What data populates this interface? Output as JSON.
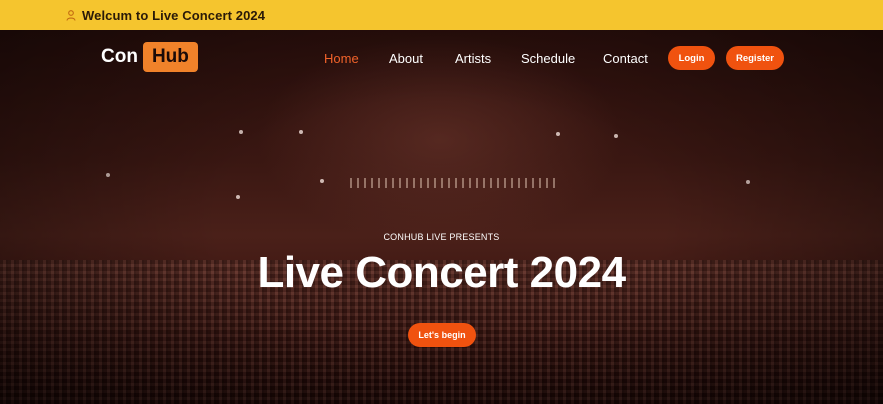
{
  "topbar": {
    "icon": "user-icon",
    "welcome_text": "Welcum to Live Concert 2024",
    "background": "#f5c52e"
  },
  "logo": {
    "part1": "Con",
    "part2": "Hub",
    "accent": "#f0822a"
  },
  "nav": {
    "items": [
      {
        "label": "Home",
        "active": true
      },
      {
        "label": "About",
        "active": false
      },
      {
        "label": "Artists",
        "active": false
      },
      {
        "label": "Schedule",
        "active": false
      },
      {
        "label": "Contact",
        "active": false
      }
    ],
    "login_label": "Login",
    "register_label": "Register"
  },
  "hero": {
    "eyebrow": "CONHUB LIVE PRESENTS",
    "title": "Live Concert 2024",
    "cta_label": "Let's begin",
    "background_image": "concert-crowd-photo"
  },
  "colors": {
    "primary": "#f0520f",
    "active_link": "#f0622a"
  }
}
